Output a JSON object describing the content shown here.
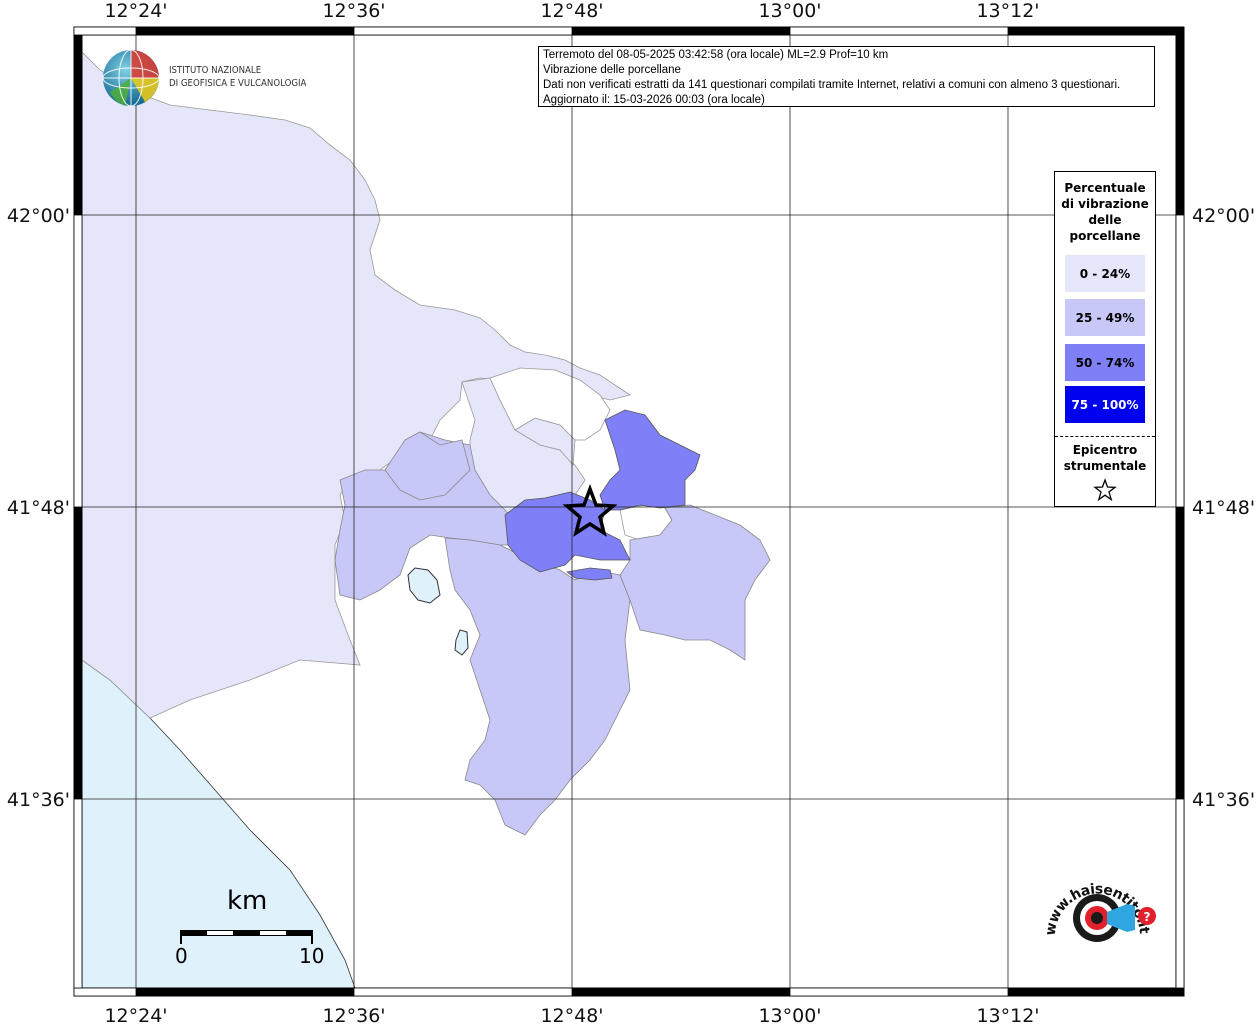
{
  "header": {
    "line1": "Terremoto del 08-05-2025 03:42:58 (ora locale) ML=2.9 Prof=10 km",
    "line2": "Vibrazione delle porcellane",
    "line3": "Dati non verificati estratti da 141 questionari compilati tramite Internet, relativi a comuni con almeno 3 questionari.",
    "line4": "Aggiornato il: 15-03-2026 00:03 (ora locale)"
  },
  "axes": {
    "lon_labels": [
      "12°24'",
      "12°36'",
      "12°48'",
      "13°00'",
      "13°12'"
    ],
    "lat_labels": [
      "42°00'",
      "41°48'",
      "41°36'"
    ]
  },
  "logo": {
    "line1": "ISTITUTO NAZIONALE",
    "line2": "DI GEOFISICA E VULCANOLOGIA"
  },
  "legend": {
    "title_lines": [
      "Percentuale",
      "di vibrazione",
      "delle",
      "porcellane"
    ],
    "classes": [
      {
        "label": "0 - 24%",
        "color": "#e6e6fa",
        "text_color": "#000000"
      },
      {
        "label": "25 - 49%",
        "color": "#c8c8f8",
        "text_color": "#000000"
      },
      {
        "label": "50 - 74%",
        "color": "#7f7ff7",
        "text_color": "#000000"
      },
      {
        "label": "75 - 100%",
        "color": "#0000ee",
        "text_color": "#ffffff"
      }
    ],
    "epicenter_lines": [
      "Epicentro",
      "strumentale"
    ]
  },
  "scale": {
    "unit": "km",
    "min_label": "0",
    "max_label": "10"
  },
  "watermark": {
    "text": "www.haisentitoilterremoto.it"
  },
  "colors": {
    "sea": "#dff2fc",
    "land_outside": "#ffffff",
    "class_0_24": "#e6e6fa",
    "class_25_49": "#c8c8f8",
    "class_50_74": "#7f7ff7"
  }
}
